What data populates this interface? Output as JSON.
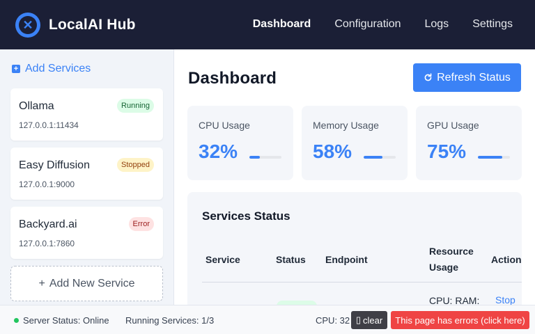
{
  "app": {
    "title": "LocalAI Hub",
    "logo_icon": "x-circle-icon",
    "accent_color": "#3b82f6",
    "header_bg": "#1b1f36"
  },
  "nav": {
    "items": [
      {
        "label": "Dashboard",
        "active": true
      },
      {
        "label": "Configuration",
        "active": false
      },
      {
        "label": "Logs",
        "active": false
      },
      {
        "label": "Settings",
        "active": false
      }
    ]
  },
  "sidebar": {
    "add_services_label": "Add Services",
    "add_services_icon": "plus-square-icon",
    "services": [
      {
        "name": "Ollama",
        "address": "127.0.0.1:11434",
        "status": "Running",
        "status_color": "#166534"
      },
      {
        "name": "Easy Diffusion",
        "address": "127.0.0.1:9000",
        "status": "Stopped",
        "status_color": "#92400e"
      },
      {
        "name": "Backyard.ai",
        "address": "127.0.0.1:7860",
        "status": "Error",
        "status_color": "#991b1b"
      }
    ],
    "add_new_label": "Add New Service",
    "add_new_icon": "plus-icon"
  },
  "main": {
    "title": "Dashboard",
    "refresh_label": "Refresh Status",
    "refresh_icon": "refresh-icon",
    "stats": [
      {
        "label": "CPU Usage",
        "value": "32%",
        "fraction": 0.32
      },
      {
        "label": "Memory Usage",
        "value": "58%",
        "fraction": 0.58
      },
      {
        "label": "GPU Usage",
        "value": "75%",
        "fraction": 0.75
      }
    ],
    "services_table": {
      "title": "Services Status",
      "headers": {
        "service": "Service",
        "status": "Status",
        "endpoint": "Endpoint",
        "resource_line1": "Resource",
        "resource_line2": "Usage",
        "actions": "Actions"
      },
      "first_row_partial": {
        "resource": "CPU: RAM:",
        "action": "Stop"
      }
    }
  },
  "footer": {
    "server_status": "Server Status: Online",
    "running_services": "Running Services: 1/3",
    "cpu": "CPU: 32",
    "clear_label": "clear",
    "error_label": "This page has errors (click here)"
  }
}
